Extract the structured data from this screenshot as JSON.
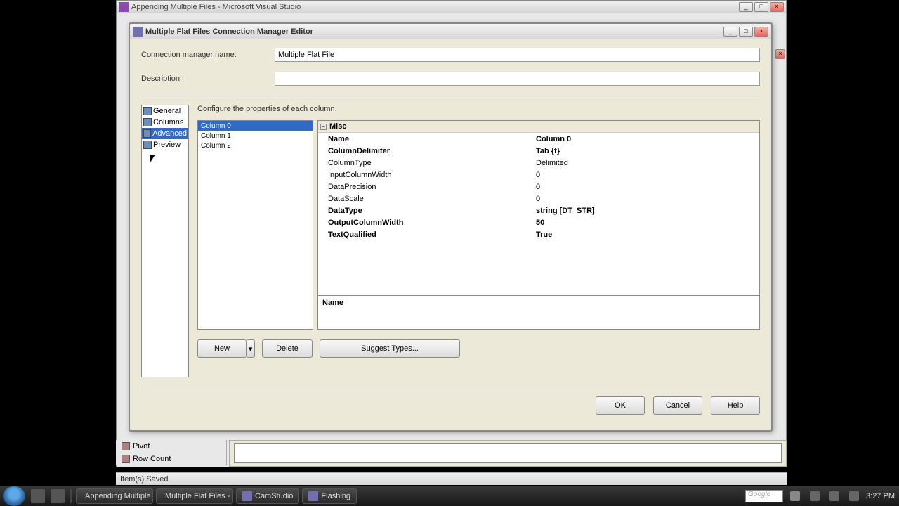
{
  "vs": {
    "title": "Appending Multiple Files - Microsoft Visual Studio"
  },
  "editor": {
    "title": "Multiple Flat Files Connection Manager Editor",
    "conn_name_label": "Connection manager name:",
    "conn_name_value": "Multiple Flat File",
    "desc_label": "Description:",
    "desc_value": "",
    "nav": [
      "General",
      "Columns",
      "Advanced",
      "Preview"
    ],
    "nav_selected_index": 2,
    "content_hint": "Configure the properties of each column.",
    "columns": [
      "Column 0",
      "Column 1",
      "Column 2"
    ],
    "columns_selected_index": 0,
    "prop_category": "Misc",
    "properties": [
      {
        "key": "Name",
        "val": "Column 0",
        "bold": true
      },
      {
        "key": "ColumnDelimiter",
        "val": "Tab {t}",
        "bold": true
      },
      {
        "key": "ColumnType",
        "val": "Delimited"
      },
      {
        "key": "InputColumnWidth",
        "val": "0"
      },
      {
        "key": "DataPrecision",
        "val": "0"
      },
      {
        "key": "DataScale",
        "val": "0"
      },
      {
        "key": "DataType",
        "val": "string [DT_STR]",
        "bold": true
      },
      {
        "key": "OutputColumnWidth",
        "val": "50",
        "bold": true
      },
      {
        "key": "TextQualified",
        "val": "True",
        "bold": true
      }
    ],
    "prop_desc_title": "Name",
    "btns": {
      "new": "New",
      "delete": "Delete",
      "suggest": "Suggest Types..."
    },
    "footer": {
      "ok": "OK",
      "cancel": "Cancel",
      "help": "Help"
    }
  },
  "toolbox": {
    "items": [
      "Pivot",
      "Row Count"
    ]
  },
  "statusbar": {
    "text": "Item(s) Saved"
  },
  "taskbar": {
    "tasks": [
      "Appending Multiple...",
      "Multiple Flat Files - ...",
      "CamStudio",
      "Flashing"
    ],
    "search_placeholder": "Google",
    "time": "3:27 PM"
  }
}
